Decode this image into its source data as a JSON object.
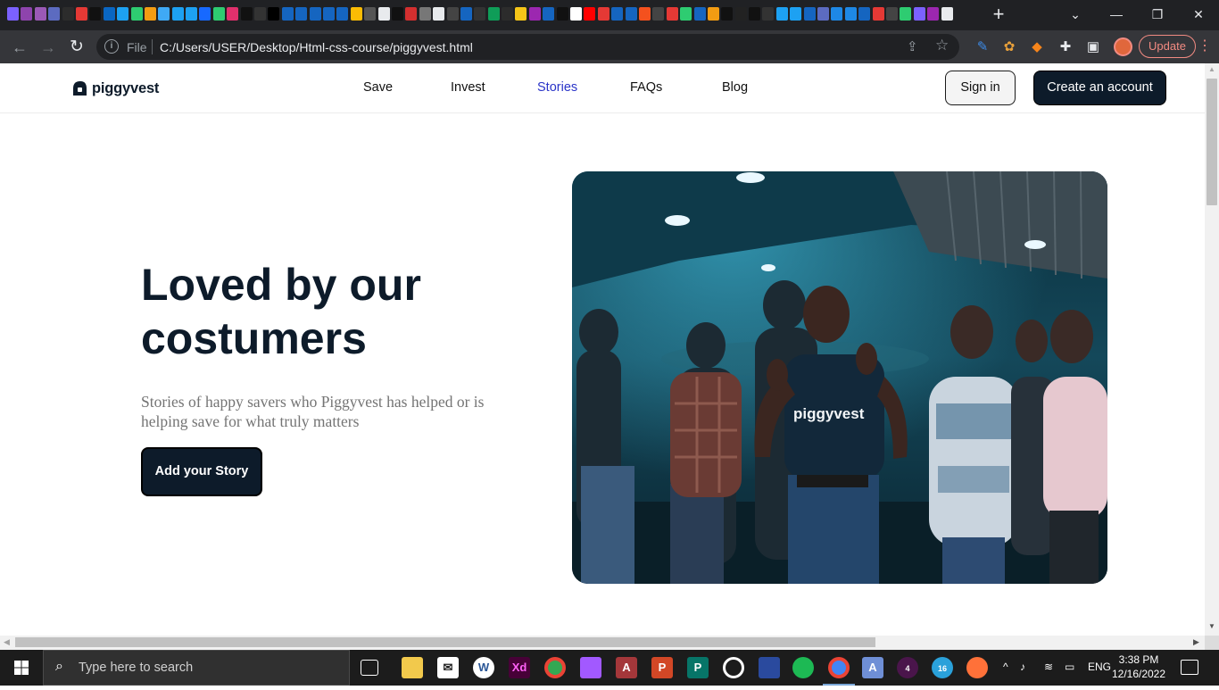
{
  "browser": {
    "tab_favicon_colors": [
      "#7b61ff",
      "#8e44ad",
      "#9b59b6",
      "#5c6bc0",
      "#2c2c2c",
      "#e53935",
      "#111111",
      "#0a66c2",
      "#1da1f2",
      "#2ecc71",
      "#f39c12",
      "#3fa9f5",
      "#1da1f2",
      "#1da1f2",
      "#1769ff",
      "#2ecc71",
      "#e1306c",
      "#111111",
      "#333333",
      "#000000",
      "#1565c0",
      "#1565c0",
      "#1565c0",
      "#1565c0",
      "#1565c0",
      "#fbbc04",
      "#555555",
      "#e8eaed",
      "#111111",
      "#d32f2f",
      "#777777",
      "#e8eaed",
      "#444444",
      "#1565c0",
      "#333333",
      "#0f9d58",
      "#2c2c2c",
      "#f5c518",
      "#9c27b0",
      "#1565c0",
      "#111111",
      "#ffffff",
      "#ff0000",
      "#e53935",
      "#1565c0",
      "#1565c0",
      "#f4511e",
      "#444444",
      "#e53935",
      "#2ecc71",
      "#1565c0",
      "#f39c12",
      "#111111",
      "#222222",
      "#111111",
      "#333333",
      "#1da1f2",
      "#1da1f2",
      "#1565c0",
      "#5c6bc0",
      "#1e88e5",
      "#1e88e5",
      "#1565c0",
      "#e53935",
      "#444444",
      "#2ecc71",
      "#7b61ff",
      "#9c27b0",
      "#e8eaed"
    ],
    "new_tab_label": "+",
    "address": {
      "scheme_label": "File",
      "url": "C:/Users/USER/Desktop/Html-css-course/piggyvest.html"
    },
    "update_label": "Update"
  },
  "site": {
    "logo_text": "piggyvest",
    "nav": [
      {
        "label": "Save"
      },
      {
        "label": "Invest"
      },
      {
        "label": "Stories"
      },
      {
        "label": "FAQs"
      },
      {
        "label": "Blog"
      }
    ],
    "signin_label": "Sign in",
    "create_label": "Create an account",
    "hero": {
      "title": "Loved by our costumers",
      "subtitle": "Stories of happy savers who Piggyvest has helped or is helping save for what truly matters",
      "cta_label": "Add your Story",
      "photo_shirt_text": "piggyvest"
    }
  },
  "taskbar": {
    "search_placeholder": "Type here to search",
    "language": "ENG",
    "time": "3:38 PM",
    "date": "12/16/2022",
    "telegram_badge": "16",
    "slack_badge": "4"
  },
  "colors": {
    "brand_dark": "#0d1b2a",
    "nav_active": "#2a34c8",
    "subtitle_gray": "#747474"
  }
}
